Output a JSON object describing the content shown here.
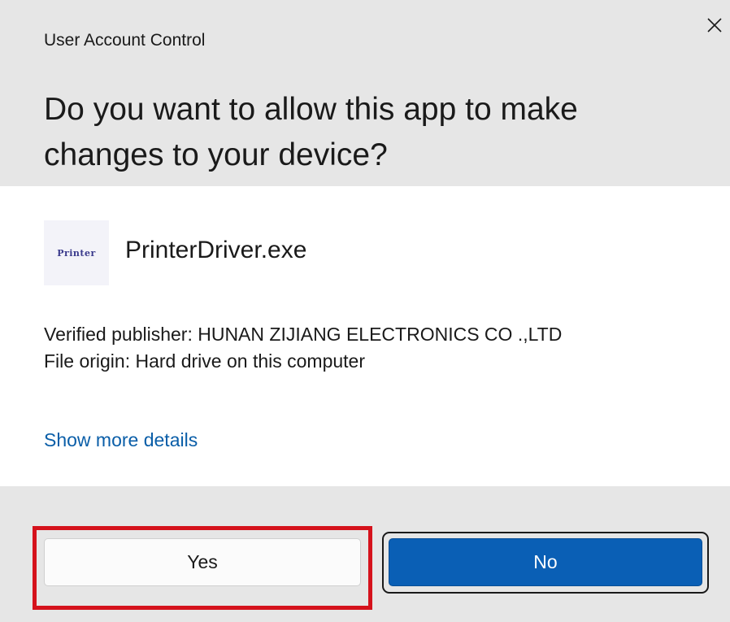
{
  "dialog": {
    "title": "User Account Control",
    "question": "Do you want to allow this app to make changes to your device?",
    "close_icon": "close-icon"
  },
  "app": {
    "icon_text": "Printer",
    "name": "PrinterDriver.exe"
  },
  "details": {
    "publisher_line": "Verified publisher: HUNAN ZIJIANG ELECTRONICS CO .,LTD",
    "origin_line": "File origin: Hard drive on this computer"
  },
  "more_details_link": "Show more details",
  "buttons": {
    "yes_label": "Yes",
    "no_label": "No"
  },
  "colors": {
    "header_bg": "#e6e6e6",
    "link": "#0a5ea8",
    "primary_button": "#0a5fb5",
    "highlight": "#d5121c"
  }
}
